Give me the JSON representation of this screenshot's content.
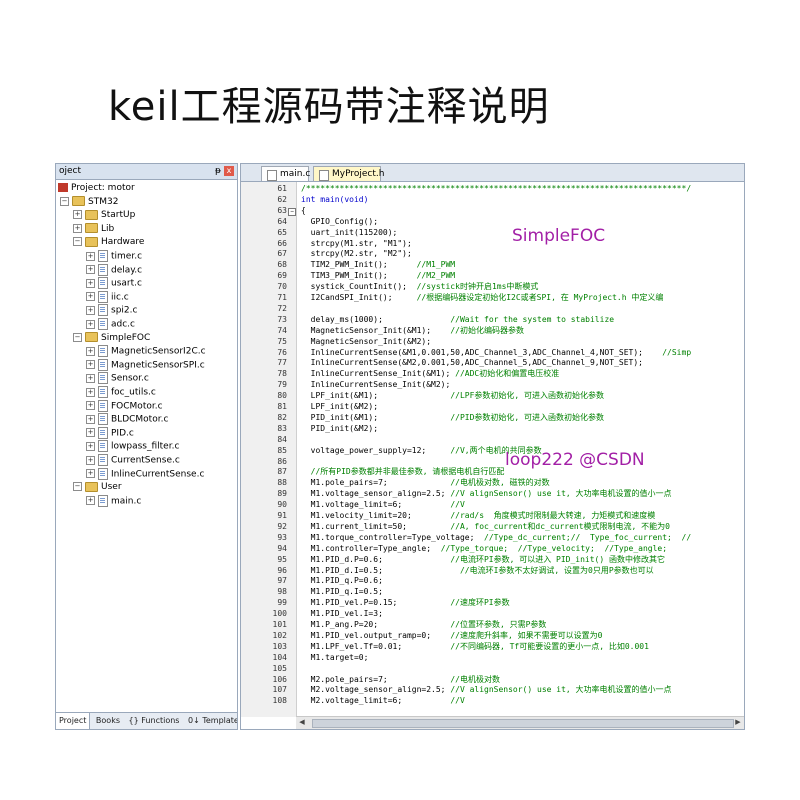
{
  "headline": "keil工程源码带注释说明",
  "project_panel": {
    "title": "oject",
    "pin": "ᵽ",
    "close": "x",
    "bottom_tabs": [
      "Project",
      "Books",
      "{} Functions",
      "0↓ Templates"
    ],
    "tree": [
      {
        "label": "Project: motor",
        "level": 0,
        "kind": "root",
        "exp": ""
      },
      {
        "label": "STM32",
        "level": 1,
        "kind": "folder",
        "exp": "−"
      },
      {
        "label": "StartUp",
        "level": 2,
        "kind": "folder",
        "exp": "+"
      },
      {
        "label": "Lib",
        "level": 2,
        "kind": "folder",
        "exp": "+"
      },
      {
        "label": "Hardware",
        "level": 2,
        "kind": "folder",
        "exp": "−"
      },
      {
        "label": "timer.c",
        "level": 3,
        "kind": "file",
        "exp": "+"
      },
      {
        "label": "delay.c",
        "level": 3,
        "kind": "file",
        "exp": "+"
      },
      {
        "label": "usart.c",
        "level": 3,
        "kind": "file",
        "exp": "+"
      },
      {
        "label": "iic.c",
        "level": 3,
        "kind": "file",
        "exp": "+"
      },
      {
        "label": "spi2.c",
        "level": 3,
        "kind": "file",
        "exp": "+"
      },
      {
        "label": "adc.c",
        "level": 3,
        "kind": "file",
        "exp": "+"
      },
      {
        "label": "SimpleFOC",
        "level": 2,
        "kind": "folder",
        "exp": "−"
      },
      {
        "label": "MagneticSensorI2C.c",
        "level": 3,
        "kind": "file",
        "exp": "+"
      },
      {
        "label": "MagneticSensorSPI.c",
        "level": 3,
        "kind": "file",
        "exp": "+"
      },
      {
        "label": "Sensor.c",
        "level": 3,
        "kind": "file",
        "exp": "+"
      },
      {
        "label": "foc_utils.c",
        "level": 3,
        "kind": "file",
        "exp": "+"
      },
      {
        "label": "FOCMotor.c",
        "level": 3,
        "kind": "file",
        "exp": "+"
      },
      {
        "label": "BLDCMotor.c",
        "level": 3,
        "kind": "file",
        "exp": "+"
      },
      {
        "label": "PID.c",
        "level": 3,
        "kind": "file",
        "exp": "+"
      },
      {
        "label": "lowpass_filter.c",
        "level": 3,
        "kind": "file",
        "exp": "+"
      },
      {
        "label": "CurrentSense.c",
        "level": 3,
        "kind": "file",
        "exp": "+"
      },
      {
        "label": "InlineCurrentSense.c",
        "level": 3,
        "kind": "file",
        "exp": "+"
      },
      {
        "label": "User",
        "level": 2,
        "kind": "folder",
        "exp": "−"
      },
      {
        "label": "main.c",
        "level": 3,
        "kind": "file",
        "exp": "+"
      }
    ]
  },
  "editor": {
    "tabs": [
      "main.c",
      "MyProject.h"
    ],
    "lines": [
      {
        "n": "61",
        "code": "/*******************************************************************************/",
        "type": "comment"
      },
      {
        "n": "62",
        "code": "int main(void)",
        "type": "keyword"
      },
      {
        "n": "63",
        "code": "{",
        "type": "plain",
        "fold": true
      },
      {
        "n": "64",
        "code": "  GPIO_Config();",
        "type": "plain"
      },
      {
        "n": "65",
        "code": "  uart_init(115200);",
        "type": "plain"
      },
      {
        "n": "66",
        "code": "  strcpy(M1.str, \"M1\");",
        "type": "plain"
      },
      {
        "n": "67",
        "code": "  strcpy(M2.str, \"M2\");",
        "type": "plain"
      },
      {
        "n": "68",
        "code": "  TIM2_PWM_Init();      //M1_PWM",
        "type": "plain"
      },
      {
        "n": "69",
        "code": "  TIM3_PWM_Init();      //M2_PWM",
        "type": "plain"
      },
      {
        "n": "70",
        "code": "  systick_CountInit();  //systick时钟开启1ms中断模式",
        "type": "plain"
      },
      {
        "n": "71",
        "code": "  I2CandSPI_Init();     //根据编码器设定初始化I2C或者SPI, 在 MyProject.h 中定义编",
        "type": "plain"
      },
      {
        "n": "72",
        "code": "",
        "type": "plain"
      },
      {
        "n": "73",
        "code": "  delay_ms(1000);              //Wait for the system to stabilize",
        "type": "plain"
      },
      {
        "n": "74",
        "code": "  MagneticSensor_Init(&M1);    //初始化编码器参数",
        "type": "plain"
      },
      {
        "n": "75",
        "code": "  MagneticSensor_Init(&M2);",
        "type": "plain"
      },
      {
        "n": "76",
        "code": "  InlineCurrentSense(&M1,0.001,50,ADC_Channel_3,ADC_Channel_4,NOT_SET);    //Simp",
        "type": "plain"
      },
      {
        "n": "77",
        "code": "  InlineCurrentSense(&M2,0.001,50,ADC_Channel_5,ADC_Channel_9,NOT_SET);",
        "type": "plain"
      },
      {
        "n": "78",
        "code": "  InlineCurrentSense_Init(&M1); //ADC初始化和偏置电压校准",
        "type": "plain"
      },
      {
        "n": "79",
        "code": "  InlineCurrentSense_Init(&M2);",
        "type": "plain"
      },
      {
        "n": "80",
        "code": "  LPF_init(&M1);               //LPF参数初始化, 可进入函数初始化参数",
        "type": "plain"
      },
      {
        "n": "81",
        "code": "  LPF_init(&M2);",
        "type": "plain"
      },
      {
        "n": "82",
        "code": "  PID_init(&M1);               //PID参数初始化, 可进入函数初始化参数",
        "type": "plain"
      },
      {
        "n": "83",
        "code": "  PID_init(&M2);",
        "type": "plain"
      },
      {
        "n": "84",
        "code": "",
        "type": "plain"
      },
      {
        "n": "85",
        "code": "  voltage_power_supply=12;     //V,两个电机的共同参数",
        "type": "plain"
      },
      {
        "n": "86",
        "code": "",
        "type": "plain"
      },
      {
        "n": "87",
        "code": "  //所有PID参数都并非最佳参数, 请根据电机自行匹配",
        "type": "comment"
      },
      {
        "n": "88",
        "code": "  M1.pole_pairs=7;             //电机极对数, 磁铁的对数",
        "type": "plain"
      },
      {
        "n": "89",
        "code": "  M1.voltage_sensor_align=2.5; //V alignSensor() use it, 大功率电机设置的值小一点",
        "type": "plain"
      },
      {
        "n": "90",
        "code": "  M1.voltage_limit=6;          //V",
        "type": "plain"
      },
      {
        "n": "91",
        "code": "  M1.velocity_limit=20;        //rad/s  角度模式时限制最大转速, 力矩模式和速度模",
        "type": "plain"
      },
      {
        "n": "92",
        "code": "  M1.current_limit=50;         //A, foc_current和dc_current模式限制电流, 不能为0",
        "type": "plain"
      },
      {
        "n": "93",
        "code": "  M1.torque_controller=Type_voltage;  //Type_dc_current;//  Type_foc_current;  //",
        "type": "plain"
      },
      {
        "n": "94",
        "code": "  M1.controller=Type_angle;  //Type_torque;  //Type_velocity;  //Type_angle;",
        "type": "plain"
      },
      {
        "n": "95",
        "code": "  M1.PID_d.P=0.6;              //电流环PI参数, 可以进入 PID_init() 函数中修改其它",
        "type": "plain"
      },
      {
        "n": "96",
        "code": "  M1.PID_d.I=0.5;                //电流环I参数不太好调试, 设置为0只用P参数也可以",
        "type": "plain"
      },
      {
        "n": "97",
        "code": "  M1.PID_q.P=0.6;",
        "type": "plain"
      },
      {
        "n": "98",
        "code": "  M1.PID_q.I=0.5;",
        "type": "plain"
      },
      {
        "n": "99",
        "code": "  M1.PID_vel.P=0.15;           //速度环PI参数",
        "type": "plain"
      },
      {
        "n": "100",
        "code": "  M1.PID_vel.I=3;",
        "type": "plain"
      },
      {
        "n": "101",
        "code": "  M1.P_ang.P=20;               //位置环参数, 只需P参数",
        "type": "plain"
      },
      {
        "n": "102",
        "code": "  M1.PID_vel.output_ramp=0;    //速度爬升斜率, 如果不需要可以设置为0",
        "type": "plain"
      },
      {
        "n": "103",
        "code": "  M1.LPF_vel.Tf=0.01;          //不同编码器, Tf可能要设置的更小一点, 比如0.001",
        "type": "plain"
      },
      {
        "n": "104",
        "code": "  M1.target=0;",
        "type": "plain"
      },
      {
        "n": "105",
        "code": "",
        "type": "plain"
      },
      {
        "n": "106",
        "code": "  M2.pole_pairs=7;             //电机极对数",
        "type": "plain"
      },
      {
        "n": "107",
        "code": "  M2.voltage_sensor_align=2.5; //V alignSensor() use it, 大功率电机设置的值小一点",
        "type": "plain"
      },
      {
        "n": "108",
        "code": "  M2.voltage_limit=6;          //V",
        "type": "plain"
      }
    ]
  },
  "overlays": {
    "simplefoc": "SimpleFOC",
    "watermark": "loop222 @CSDN"
  },
  "colors": {
    "comment": "#008000",
    "keyword": "#0000cc",
    "overlay": "#a21fa6"
  }
}
